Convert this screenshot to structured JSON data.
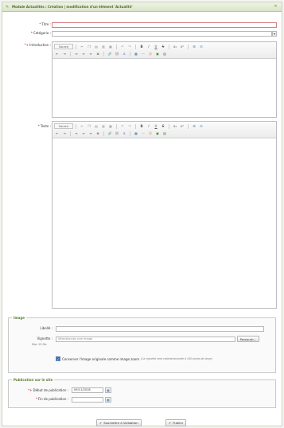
{
  "window": {
    "title": "Module Actualités : Création | modification d'un élément 'Actualité'"
  },
  "form": {
    "titre_label": "Titre :",
    "categorie_label": "Catégorie :",
    "intro_label": "Introduction :",
    "texte_label": "Texte :",
    "required_marker": "*",
    "intro_extra_marker": "*+"
  },
  "editor": {
    "source_label": "Source"
  },
  "image": {
    "legend": "Image",
    "libelle_label": "Libellé :",
    "vignette_label": "Vignette :",
    "vignette_max": "Max 10 Mo",
    "file_placeholder": "Sélectionnez une image",
    "browse_label": "Parcourir...",
    "conserve_label": "Conserver l'image originale comme image zoom",
    "conserve_note": "(La vignette sera redimensionnée à 150 pixels de large)"
  },
  "publication": {
    "legend": "Publication sur le site",
    "debut_label": "Début de publication :",
    "debut_value": "09/11/2018",
    "fin_label": "Fin de publication :"
  },
  "buttons": {
    "submit_validation": "Soumettre à Validation",
    "publish": "Publier"
  }
}
